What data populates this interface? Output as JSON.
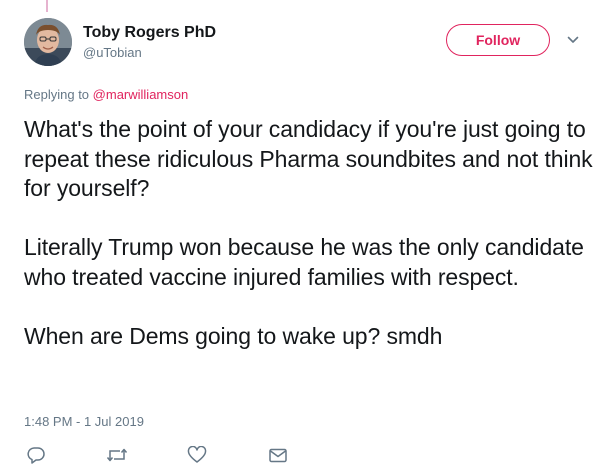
{
  "author": {
    "display_name": "Toby Rogers PhD",
    "handle": "@uTobian"
  },
  "follow_button": {
    "label": "Follow"
  },
  "reply_context": {
    "prefix": "Replying to",
    "mention": "@marwilliamson"
  },
  "tweet": {
    "paragraphs": [
      "What's the point of your candidacy if you're just going to repeat these ridiculous Pharma soundbites and not think for yourself?",
      "Literally Trump won because he was the only candidate who treated vaccine injured families with respect.",
      "When are Dems going to wake up? smdh"
    ],
    "timestamp": "1:48 PM - 1 Jul 2019"
  },
  "icons": {
    "caret": "chevron-down-icon",
    "reply": "reply-icon",
    "retweet": "retweet-icon",
    "like": "heart-icon",
    "message": "envelope-icon"
  },
  "colors": {
    "accent": "#e0245e",
    "secondary_text": "#657786",
    "primary_text": "#14171a",
    "icon": "#657786"
  }
}
